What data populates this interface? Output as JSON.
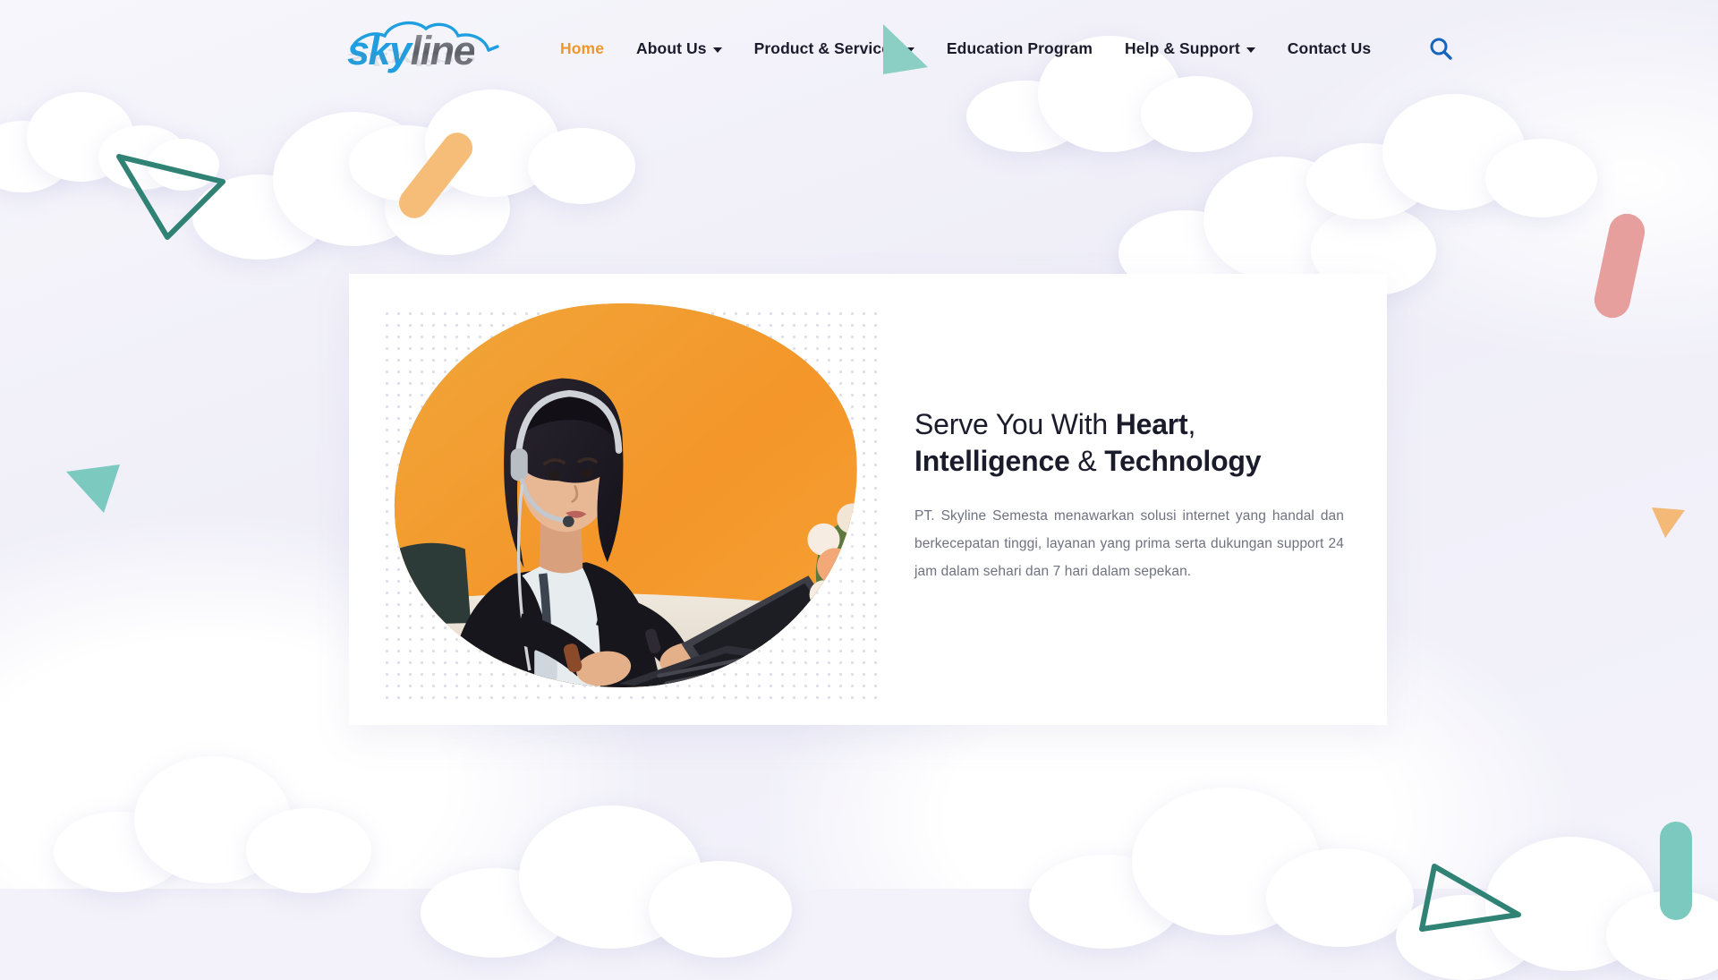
{
  "site": {
    "background_color": "#f3f2fa",
    "accent_color": "#f0972c",
    "logo": {
      "part1": "sky",
      "part2": "line",
      "icon": "cloud-outline",
      "color1": "#1f9fe0",
      "color2": "#7b7d85"
    }
  },
  "header": {
    "nav": [
      {
        "label": "Home",
        "active": true,
        "dropdown": false
      },
      {
        "label": "About Us",
        "active": false,
        "dropdown": true
      },
      {
        "label": "Product & Services",
        "active": false,
        "dropdown": true
      },
      {
        "label": "Education Program",
        "active": false,
        "dropdown": false
      },
      {
        "label": "Help & Support",
        "active": false,
        "dropdown": true
      },
      {
        "label": "Contact Us",
        "active": false,
        "dropdown": false
      }
    ],
    "search": {
      "icon": "search-icon",
      "color": "#1565c0"
    }
  },
  "hero": {
    "title_plain_1": "Serve You With ",
    "title_bold_1": "Heart",
    "title_sep": ", ",
    "title_bold_2": "Intelligence",
    "title_plain_2": " & ",
    "title_bold_3": "Technology",
    "description": "PT. Skyline Semesta menawarkan solusi internet yang handal dan berkecepatan tinggi, layanan yang prima serta dukungan support 24 jam dalam sehari dan 7 hari dalam sepekan.",
    "image_alt": "Customer service agent wearing a headset working on a laptop",
    "blob_colors": [
      "#f59a25",
      "#e8b23a",
      "#1f7fc4"
    ]
  },
  "decorations": [
    {
      "name": "triangle-outline-teal-top-left",
      "shape": "triangle-outline",
      "color": "#2f8274"
    },
    {
      "name": "pill-orange-top",
      "shape": "pill",
      "color": "#f5bd78"
    },
    {
      "name": "triangle-solid-mint-left",
      "shape": "triangle",
      "color": "#7cc9bf"
    },
    {
      "name": "pill-pink-right",
      "shape": "pill",
      "color": "#e79f9d"
    },
    {
      "name": "triangle-solid-orange-right",
      "shape": "triangle",
      "color": "#f4b877"
    },
    {
      "name": "triangle-solid-mint-nav",
      "shape": "triangle",
      "color": "#8bcfc4"
    },
    {
      "name": "pill-teal-bottom-right",
      "shape": "pill",
      "color": "#7cc9bf"
    },
    {
      "name": "triangle-outline-teal-bottom",
      "shape": "triangle-outline",
      "color": "#2f8274"
    }
  ]
}
